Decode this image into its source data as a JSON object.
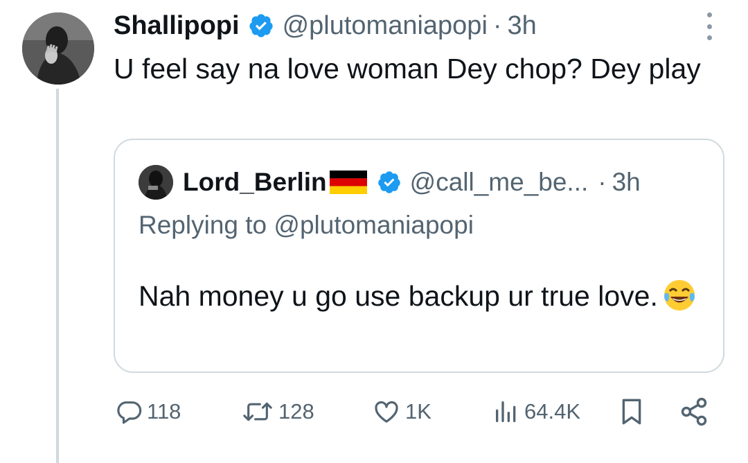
{
  "author": {
    "name": "Shallipopi",
    "handle": "@plutomaniapopi",
    "separator": "·",
    "time": "3h"
  },
  "tweet": {
    "text": "U feel say na love woman Dey chop? Dey play"
  },
  "quote": {
    "name": "Lord_Berlin",
    "handle": "@call_me_be...",
    "separator": "·",
    "time": "3h",
    "replying_prefix": "Replying to ",
    "replying_handle": "@plutomaniapopi",
    "text": "Nah money u go use backup ur true love.",
    "emoji": "face-with-tears-of-joy"
  },
  "actions": {
    "replies": "118",
    "reposts": "128",
    "likes": "1K",
    "views": "64.4K"
  },
  "colors": {
    "verified": "#1d9bf0",
    "secondary_text": "#536471",
    "border": "#cfd9de",
    "text": "#0f1419"
  },
  "icons": [
    "verified-badge-icon",
    "more-options-icon",
    "reply-icon",
    "repost-icon",
    "like-icon",
    "views-icon",
    "bookmark-icon",
    "share-icon",
    "germany-flag-icon"
  ]
}
